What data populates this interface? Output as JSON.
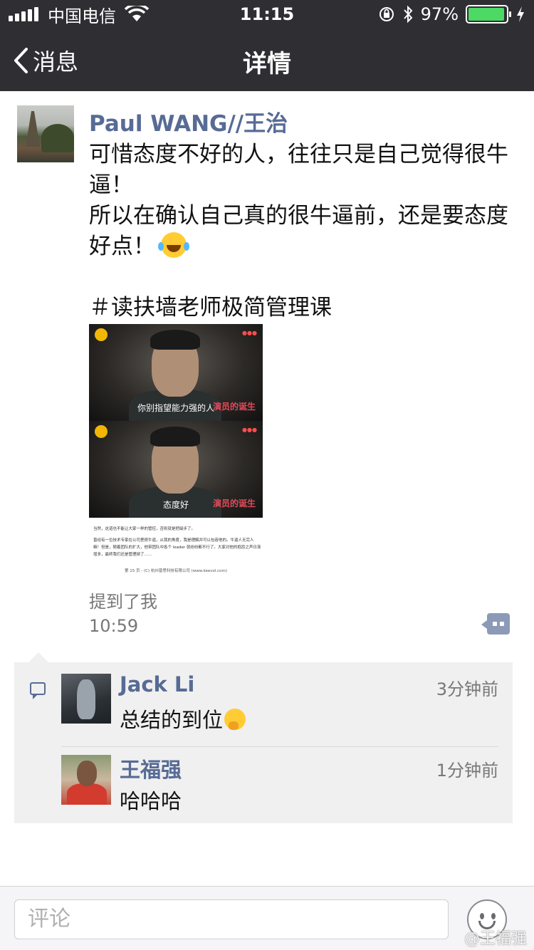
{
  "status_bar": {
    "carrier": "中国电信",
    "time": "11:15",
    "battery": "97%",
    "battery_level": 0.97
  },
  "nav": {
    "back_label": "消息",
    "title": "详情"
  },
  "post": {
    "author": "Paul WANG//王治",
    "lines": [
      "可惜态度不好的人，往往只是自己觉得很牛逼！",
      "所以在确认自己真的很牛逼前，还是要态度好点！"
    ],
    "hashtag": "＃读扶墙老师极简管理课",
    "image": {
      "frame1_caption": "你别指望能力强的人",
      "frame2_caption": "态度好",
      "brand": "演员的诞生",
      "doc_line1": "当然，这道也不能让大家一样的管控，否则就是把级步了。",
      "doc_line2": "曾经有一位技术专家在公司里很牛逼，从我的角度，我是理解并可以包容他的。牛逼人无完人嘛！但是，随着团队的扩大，他带团队中各个 leader 就纷纷都不行了。大家对他的抱怨之声日渐增多，最终我们还是管理掉了……",
      "doc_footer": "第 15 页 - (C) 杭州普思科技有限公司 (www.keevol.com)"
    },
    "mention": "提到了我",
    "time": "10:59"
  },
  "comments": [
    {
      "name": "Jack Li",
      "time": "3分钟前",
      "text": "总结的到位"
    },
    {
      "name": "王福强",
      "time": "1分钟前",
      "text": "哈哈哈"
    }
  ],
  "input": {
    "placeholder": "评论"
  },
  "watermark": "@王福强"
}
